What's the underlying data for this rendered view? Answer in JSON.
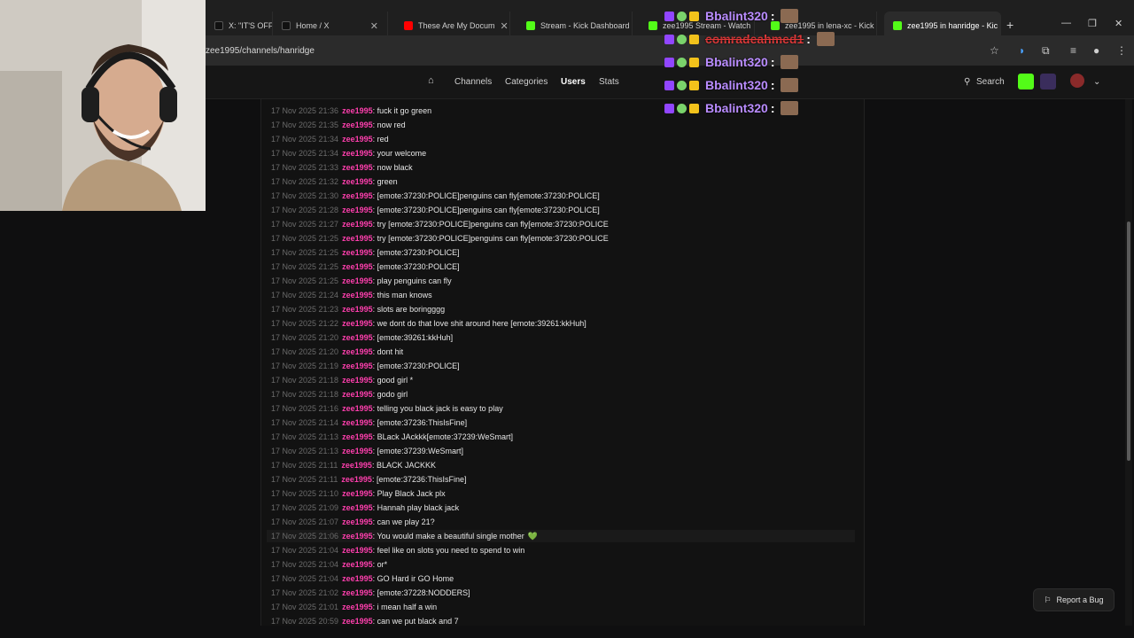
{
  "browser": {
    "tabs": [
      {
        "label": "X: \"IT'S OFF",
        "color": "#111111"
      },
      {
        "label": "Home / X",
        "color": "#111111"
      },
      {
        "label": "These Are My Docum",
        "color": "#ff0000"
      },
      {
        "label": "Stream - Kick Dashboard",
        "color": "#53fc18"
      },
      {
        "label": "zee1995 Stream - Watch",
        "color": "#53fc18"
      },
      {
        "label": "zee1995 in lena-xc - Kick",
        "color": "#53fc18"
      },
      {
        "label": "zee1995 in hanridge - Kic",
        "color": "#53fc18"
      }
    ],
    "url": "zee1995/channels/hanridge"
  },
  "nav": {
    "home_icon": "home-icon",
    "items": [
      "Channels",
      "Categories",
      "Users",
      "Stats"
    ],
    "active": "Users",
    "search_label": "Search"
  },
  "chat_log": [
    {
      "ts": "17 Nov 2025 21:36",
      "user": "zee1995",
      "msg": "fuck it go green"
    },
    {
      "ts": "17 Nov 2025 21:35",
      "user": "zee1995",
      "msg": "now red"
    },
    {
      "ts": "17 Nov 2025 21:34",
      "user": "zee1995",
      "msg": "red"
    },
    {
      "ts": "17 Nov 2025 21:34",
      "user": "zee1995",
      "msg": "your welcome"
    },
    {
      "ts": "17 Nov 2025 21:33",
      "user": "zee1995",
      "msg": "now black"
    },
    {
      "ts": "17 Nov 2025 21:32",
      "user": "zee1995",
      "msg": "green"
    },
    {
      "ts": "17 Nov 2025 21:30",
      "user": "zee1995",
      "msg": "[emote:37230:POLICE]penguins can fly[emote:37230:POLICE]"
    },
    {
      "ts": "17 Nov 2025 21:28",
      "user": "zee1995",
      "msg": "[emote:37230:POLICE]penguins can fly[emote:37230:POLICE]"
    },
    {
      "ts": "17 Nov 2025 21:27",
      "user": "zee1995",
      "msg": "try [emote:37230:POLICE]penguins can fly[emote:37230:POLICE"
    },
    {
      "ts": "17 Nov 2025 21:25",
      "user": "zee1995",
      "msg": "try [emote:37230:POLICE]penguins can fly[emote:37230:POLICE"
    },
    {
      "ts": "17 Nov 2025 21:25",
      "user": "zee1995",
      "msg": "[emote:37230:POLICE]"
    },
    {
      "ts": "17 Nov 2025 21:25",
      "user": "zee1995",
      "msg": "[emote:37230:POLICE]"
    },
    {
      "ts": "17 Nov 2025 21:25",
      "user": "zee1995",
      "msg": "play penguins can fly"
    },
    {
      "ts": "17 Nov 2025 21:24",
      "user": "zee1995",
      "msg": "this man knows"
    },
    {
      "ts": "17 Nov 2025 21:23",
      "user": "zee1995",
      "msg": "slots are boringggg"
    },
    {
      "ts": "17 Nov 2025 21:22",
      "user": "zee1995",
      "msg": "we dont do that love shit around here [emote:39261:kkHuh]"
    },
    {
      "ts": "17 Nov 2025 21:20",
      "user": "zee1995",
      "msg": "[emote:39261:kkHuh]"
    },
    {
      "ts": "17 Nov 2025 21:20",
      "user": "zee1995",
      "msg": "dont hit"
    },
    {
      "ts": "17 Nov 2025 21:19",
      "user": "zee1995",
      "msg": "[emote:37230:POLICE]"
    },
    {
      "ts": "17 Nov 2025 21:18",
      "user": "zee1995",
      "msg": "good girl *"
    },
    {
      "ts": "17 Nov 2025 21:18",
      "user": "zee1995",
      "msg": "godo girl"
    },
    {
      "ts": "17 Nov 2025 21:16",
      "user": "zee1995",
      "msg": "telling you black jack is easy to play"
    },
    {
      "ts": "17 Nov 2025 21:14",
      "user": "zee1995",
      "msg": "[emote:37236:ThisIsFine]"
    },
    {
      "ts": "17 Nov 2025 21:13",
      "user": "zee1995",
      "msg": "BLack JAckkk[emote:37239:WeSmart]"
    },
    {
      "ts": "17 Nov 2025 21:13",
      "user": "zee1995",
      "msg": "[emote:37239:WeSmart]"
    },
    {
      "ts": "17 Nov 2025 21:11",
      "user": "zee1995",
      "msg": "BLACK JACKKK"
    },
    {
      "ts": "17 Nov 2025 21:11",
      "user": "zee1995",
      "msg": "[emote:37236:ThisIsFine]"
    },
    {
      "ts": "17 Nov 2025 21:10",
      "user": "zee1995",
      "msg": "Play Black Jack plx"
    },
    {
      "ts": "17 Nov 2025 21:09",
      "user": "zee1995",
      "msg": "Hannah play black jack"
    },
    {
      "ts": "17 Nov 2025 21:07",
      "user": "zee1995",
      "msg": "can we play 21?"
    },
    {
      "ts": "17 Nov 2025 21:06",
      "user": "zee1995",
      "msg": "You would make a beautiful single mother",
      "heart": "💚"
    },
    {
      "ts": "17 Nov 2025 21:04",
      "user": "zee1995",
      "msg": "feel like on slots you need to spend to win"
    },
    {
      "ts": "17 Nov 2025 21:04",
      "user": "zee1995",
      "msg": "or*"
    },
    {
      "ts": "17 Nov 2025 21:04",
      "user": "zee1995",
      "msg": "GO Hard ir GO Home"
    },
    {
      "ts": "17 Nov 2025 21:02",
      "user": "zee1995",
      "msg": "[emote:37228:NODDERS]"
    },
    {
      "ts": "17 Nov 2025 21:01",
      "user": "zee1995",
      "msg": "i mean half a win"
    },
    {
      "ts": "17 Nov 2025 20:59",
      "user": "zee1995",
      "msg": "can we put black and 7"
    }
  ],
  "overlay_chat": [
    {
      "name": "Bbalint320",
      "color": "#b98cff"
    },
    {
      "name": "comradeahmed1",
      "color": "#e23a3a"
    },
    {
      "name": "Bbalint320",
      "color": "#b98cff"
    },
    {
      "name": "Bbalint320",
      "color": "#b98cff"
    },
    {
      "name": "Bbalint320",
      "color": "#b98cff"
    }
  ],
  "report_label": "Report a Bug",
  "colors": {
    "username": "#ff3fae",
    "kick_green": "#53fc18",
    "bg": "#121212"
  }
}
